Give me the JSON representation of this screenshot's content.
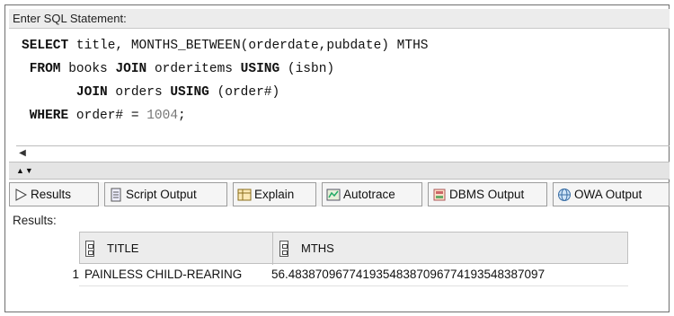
{
  "sql": {
    "header_label": "Enter SQL Statement:",
    "line1": {
      "kw1": "SELECT",
      "rest": " title, MONTHS_BETWEEN(orderdate,pubdate) MTHS"
    },
    "line2": {
      "indent": " ",
      "kw1": "FROM",
      "mid": " books ",
      "kw2": "JOIN",
      "rest": " orderitems ",
      "kw3": "USING",
      "tail": " (isbn)"
    },
    "line3": {
      "indent": "       ",
      "kw1": "JOIN",
      "mid": " orders ",
      "kw2": "USING",
      "rest": " (order#)"
    },
    "line4": {
      "indent": " ",
      "kw1": "WHERE",
      "mid": " order# = ",
      "num": "1004",
      "tail": ";"
    }
  },
  "tabs": [
    {
      "label": "Results",
      "icon": "triangle-play-icon"
    },
    {
      "label": "Script Output",
      "icon": "document-icon"
    },
    {
      "label": "Explain",
      "icon": "table-icon"
    },
    {
      "label": "Autotrace",
      "icon": "trace-icon"
    },
    {
      "label": "DBMS Output",
      "icon": "dbms-icon"
    },
    {
      "label": "OWA Output",
      "icon": "globe-icon"
    }
  ],
  "results": {
    "label": "Results:",
    "columns": [
      "TITLE",
      "MTHS"
    ],
    "rows": [
      {
        "num": "1",
        "title": "PAINLESS CHILD-REARING",
        "mths": "56.48387096774193548387096774193548387097"
      }
    ]
  },
  "colors": {
    "header_bg": "#ececec",
    "number_literal": "#777777",
    "border": "#9c9c9c"
  }
}
